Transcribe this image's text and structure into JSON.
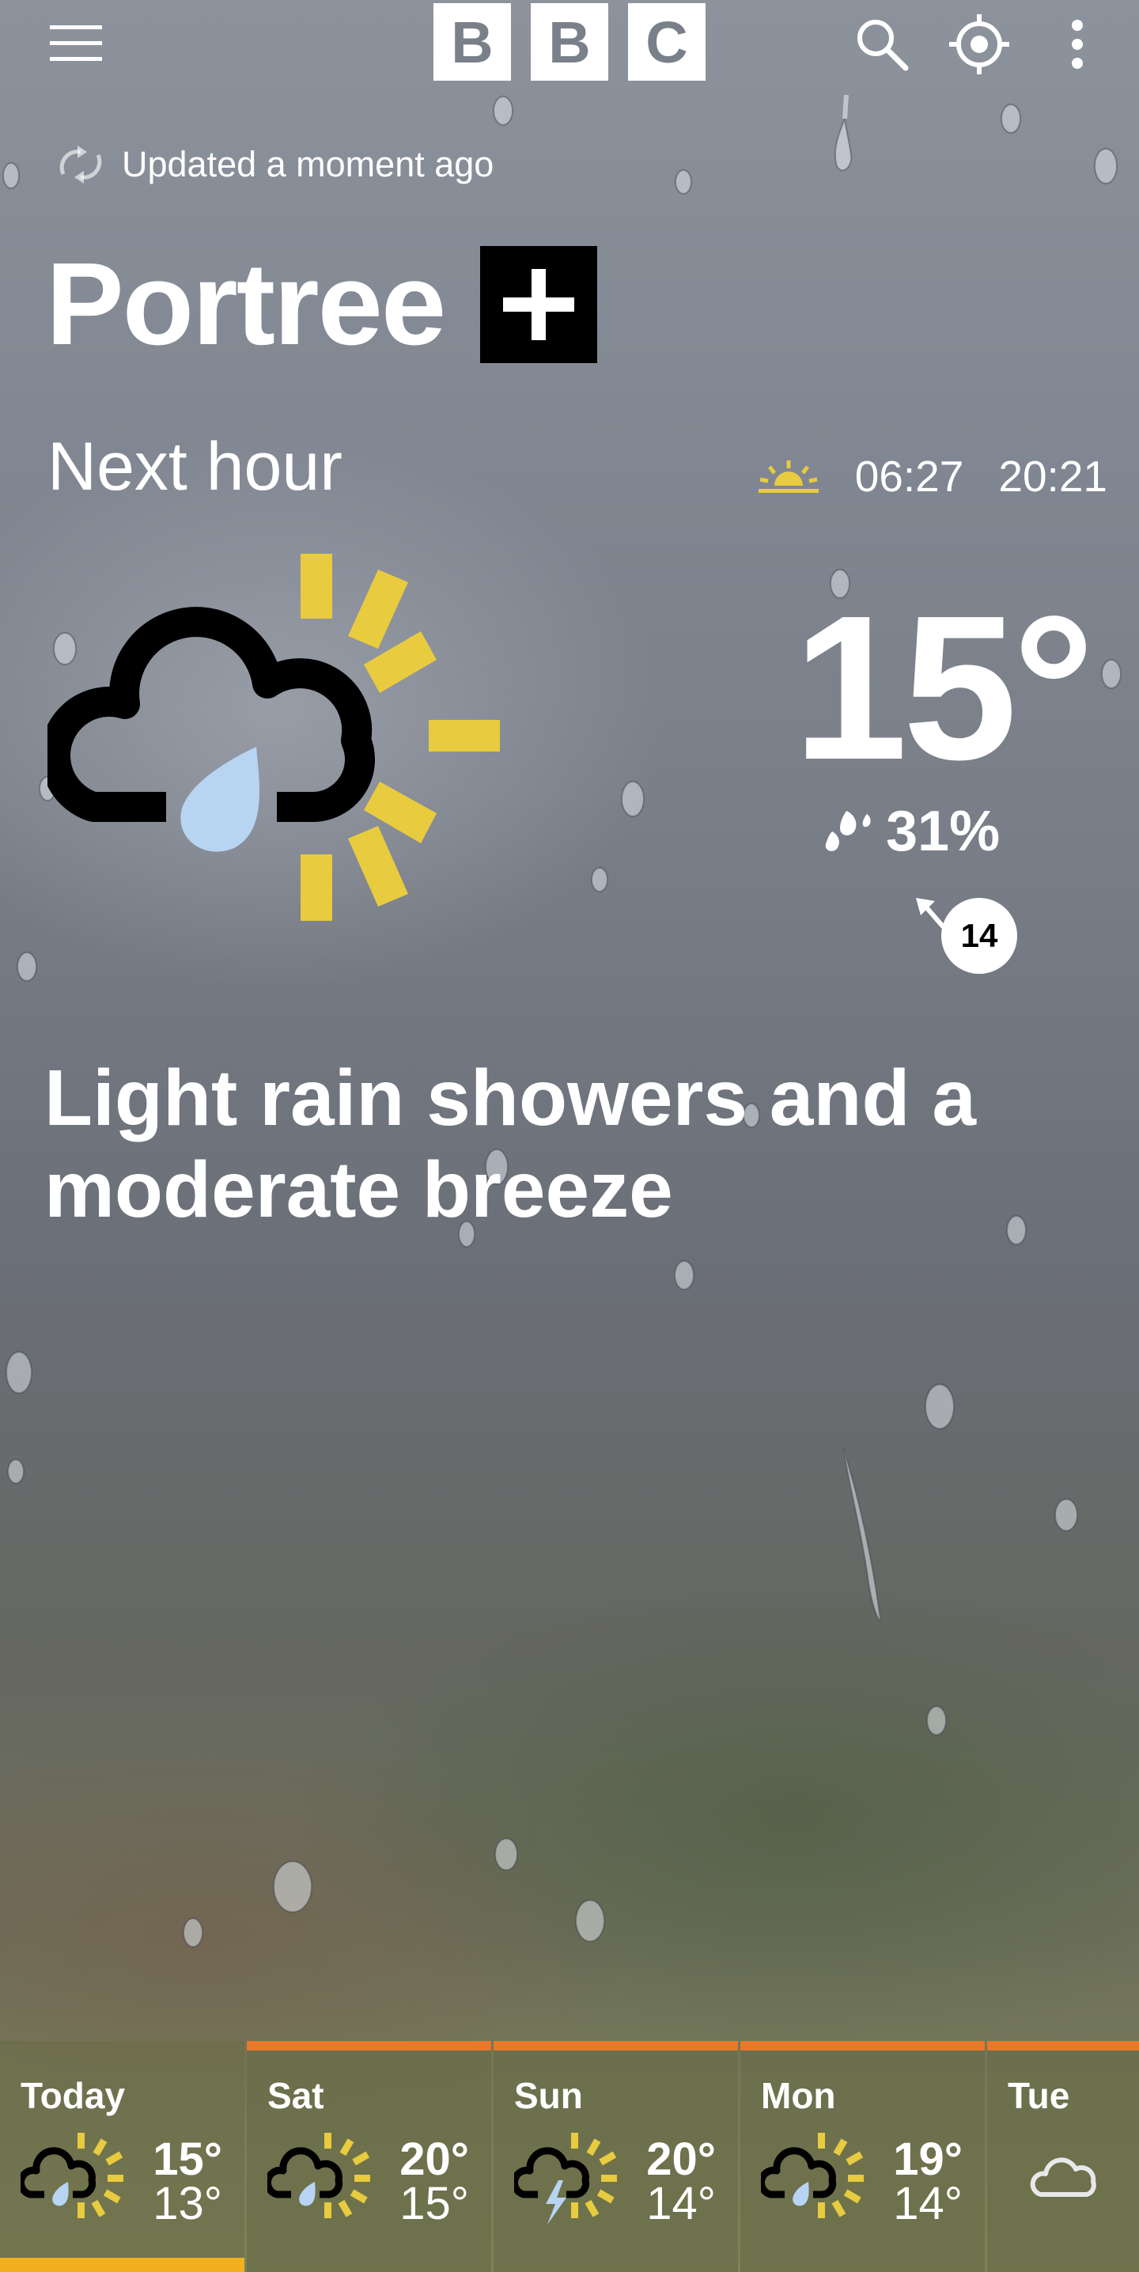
{
  "header": {
    "logo_letters": [
      "B",
      "B",
      "C"
    ]
  },
  "status": {
    "updated_text": "Updated a moment ago"
  },
  "location": {
    "name": "Portree"
  },
  "current": {
    "period_label": "Next hour",
    "sunrise": "06:27",
    "sunset": "20:21",
    "temperature": "15°",
    "humidity": "31%",
    "wind_speed": "14",
    "icon": "light-rain-showers-sunny-intervals-icon",
    "summary": "Light rain showers and a moderate breeze"
  },
  "forecast": [
    {
      "day": "Today",
      "high": "15°",
      "low": "13°",
      "icon": "light-rain-showers-icon"
    },
    {
      "day": "Sat",
      "high": "20°",
      "low": "15°",
      "icon": "light-rain-showers-icon"
    },
    {
      "day": "Sun",
      "high": "20°",
      "low": "14°",
      "icon": "thunder-showers-icon"
    },
    {
      "day": "Mon",
      "high": "19°",
      "low": "14°",
      "icon": "light-rain-showers-icon"
    },
    {
      "day": "Tue",
      "high": "",
      "low": "",
      "icon": "cloud-icon"
    }
  ],
  "colors": {
    "sun_yellow": "#e8cb3f",
    "rain_blue": "#b7d4f2",
    "forecast_accent": "#e8792b",
    "today_underline": "#f2b01e"
  }
}
